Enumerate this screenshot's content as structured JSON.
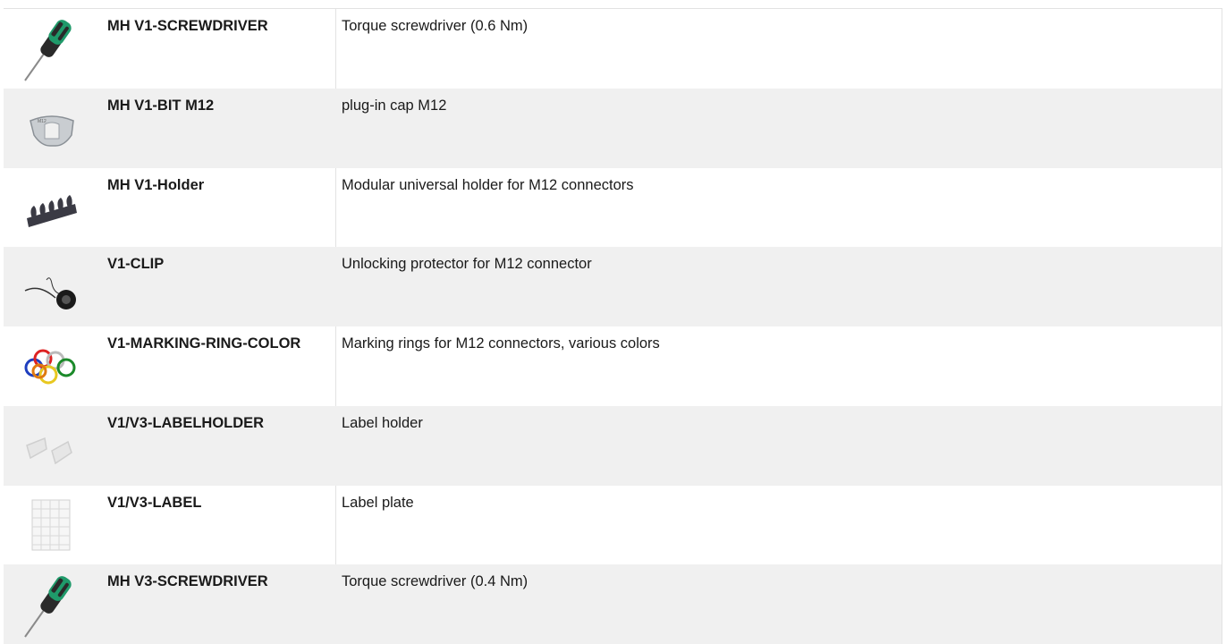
{
  "rows": [
    {
      "name": "MH V1-SCREWDRIVER",
      "description": "Torque screwdriver (0.6 Nm)",
      "icon": "screwdriver-icon"
    },
    {
      "name": "MH V1-BIT M12",
      "description": "plug-in cap M12",
      "icon": "bit-cap-icon"
    },
    {
      "name": "MH V1-Holder",
      "description": "Modular universal holder for M12 connectors",
      "icon": "holder-icon"
    },
    {
      "name": "V1-CLIP",
      "description": "Unlocking protector for M12 connector",
      "icon": "clip-icon"
    },
    {
      "name": "V1-MARKING-RING-COLOR",
      "description": "Marking rings for M12 connectors, various colors",
      "icon": "marking-rings-icon"
    },
    {
      "name": "V1/V3-LABELHOLDER",
      "description": "Label holder",
      "icon": "labelholder-icon"
    },
    {
      "name": "V1/V3-LABEL",
      "description": "Label plate",
      "icon": "label-plate-icon"
    },
    {
      "name": "MH V3-SCREWDRIVER",
      "description": "Torque screwdriver (0.4 Nm)",
      "icon": "screwdriver-icon"
    }
  ],
  "colors": {
    "row_alt": "#f0f0f0",
    "screwdriver_green": "#1f9a6a",
    "screwdriver_dark": "#2a2a2a"
  }
}
